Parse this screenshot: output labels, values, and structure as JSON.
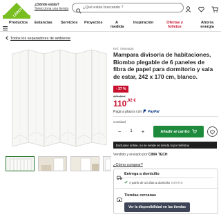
{
  "header": {
    "logo_text": "LEROY MERLIN",
    "location_question": "¿Dónde estás?",
    "location_link": "Selecciona una tienda",
    "search_placeholder": "¿Qué estás buscando ?",
    "icons": [
      "user-icon",
      "heart-icon",
      "cart-icon"
    ]
  },
  "nav": {
    "items": [
      {
        "label": "Productos"
      },
      {
        "label": "Estancias"
      },
      {
        "label": "Servicios"
      },
      {
        "label": "Proyectos"
      },
      {
        "label": "A medida"
      },
      {
        "label": "Inspiración"
      },
      {
        "label": "Ofertas y folletos"
      },
      {
        "label": "Ahorra energía"
      }
    ]
  },
  "breadcrumb": {
    "label": "Todos los separadores de ambiente"
  },
  "product": {
    "ref": "Ref. 79064535",
    "title": "Mampara divisoria de habitaciones, Biombo plegable de 6 paneles de fibra de papel para dormitorio y sala de estar, 242 x 170 cm, blanco.",
    "discount": "- 37 %",
    "old_price": "177,40 €",
    "price_int": "110",
    "price_dec": ",92 €",
    "paypal_text": "Paga a plazos con",
    "paypal_brand": "PayPal",
    "qty_label": "Cantidad",
    "qty_value": "1",
    "add_to_cart": "Añadir al carrito",
    "notice": "Exclusivo online, no se vende en tienda ni por teléfono",
    "sold_by_label": "Vendido y enviado por",
    "sold_by_name": "CIMA TECH",
    "how_to_buy": "¿Cómo comprar?",
    "delivery_title": "Entrega a domicilio",
    "delivery_sub": "A partir de 10 días a domicilio",
    "delivery_free": "GRATIS",
    "stores_title": "Tiendas cercanas",
    "stock_button": "Ver la disponibilidad en las tiendas"
  },
  "colors": {
    "brand_green": "#1e8a3c",
    "price_red": "#c8102e",
    "notice_bg": "#1f1f1f",
    "stock_btn": "#3d4556"
  }
}
